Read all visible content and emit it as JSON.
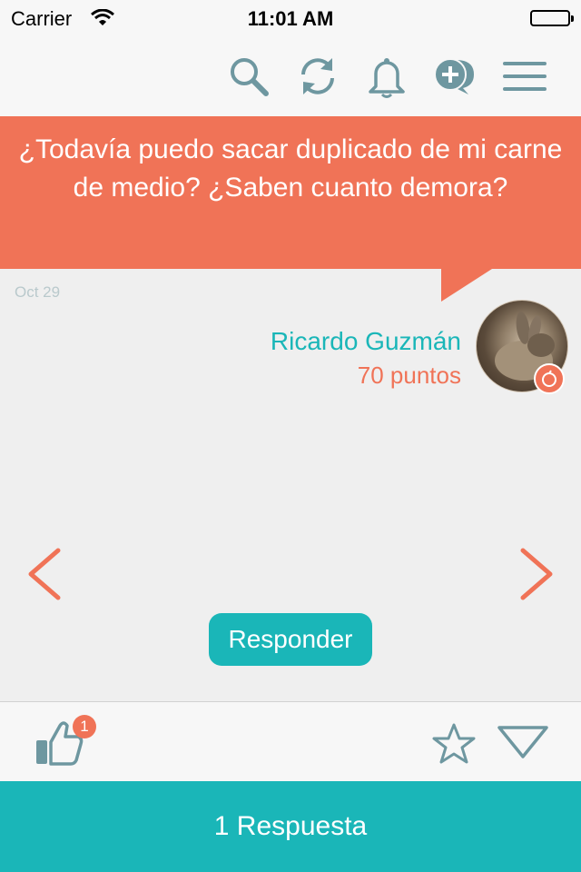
{
  "status_bar": {
    "carrier": "Carrier",
    "time": "11:01 AM",
    "battery_level": 1.0
  },
  "nav": {
    "icons": [
      "search-icon",
      "refresh-icon",
      "bell-icon",
      "new-question-icon",
      "menu-icon"
    ],
    "icon_color": "#6e97a0"
  },
  "question": {
    "text": "¿Todavía puedo sacar duplicado de mi carne de medio? ¿Saben cuanto demora?",
    "date": "Oct 29",
    "author": {
      "name": "Ricardo Guzmán",
      "points": "70 puntos",
      "badge_icon": "apple-icon"
    }
  },
  "actions": {
    "reply_label": "Responder",
    "like_count": "1",
    "answers_label": "1 Respuesta"
  },
  "colors": {
    "accent": "#f07357",
    "teal": "#1ab6b8"
  }
}
